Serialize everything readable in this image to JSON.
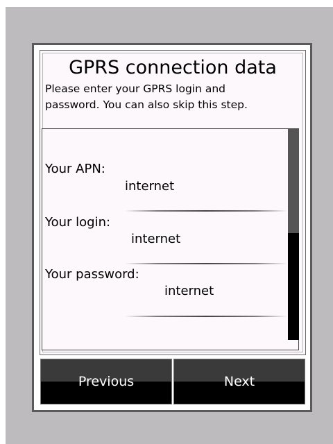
{
  "header": {
    "title": "GPRS connection data",
    "description": "Please enter your GPRS login and\npassword. You can also skip this step."
  },
  "form": {
    "apn": {
      "label": "Your APN:",
      "value": "internet"
    },
    "login": {
      "label": "Your login:",
      "value": "internet"
    },
    "password": {
      "label": "Your password:",
      "value": "internet"
    }
  },
  "scrollbar": {
    "position": 0
  },
  "buttons": {
    "previous": "Previous",
    "next": "Next"
  }
}
